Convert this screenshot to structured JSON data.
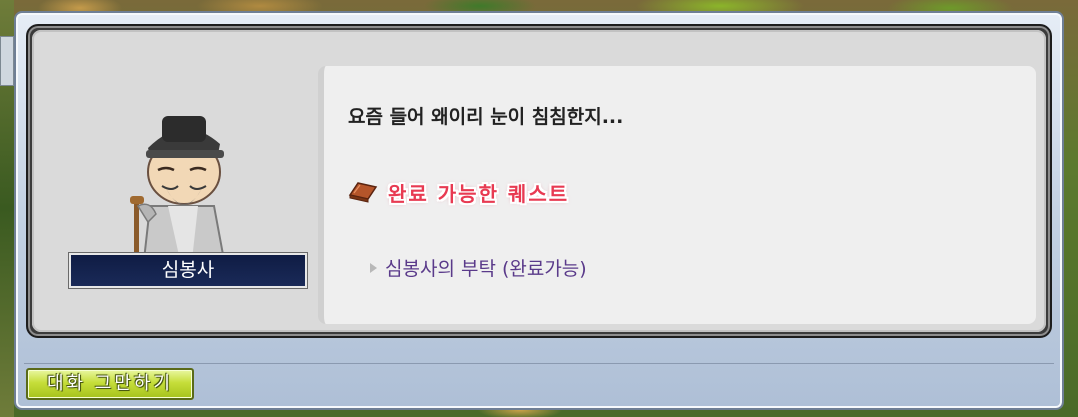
{
  "npc": {
    "name": "심봉사"
  },
  "dialog": {
    "text": "요즘 들어 왜이리 눈이 침침한지..."
  },
  "quests": {
    "header_label": "완료 가능한 퀘스트",
    "items": [
      {
        "label": "심봉사의 부탁 (완료가능)"
      }
    ]
  },
  "buttons": {
    "end_chat_label": "대화 그만하기"
  },
  "icons": {
    "quest_header": "book-icon",
    "quest_item": "arrow-right-icon"
  },
  "colors": {
    "quest_header": "#e83a52",
    "quest_item": "#5a3a8a",
    "name_plate": "#0f1c44",
    "end_button": "#c6de3a"
  }
}
